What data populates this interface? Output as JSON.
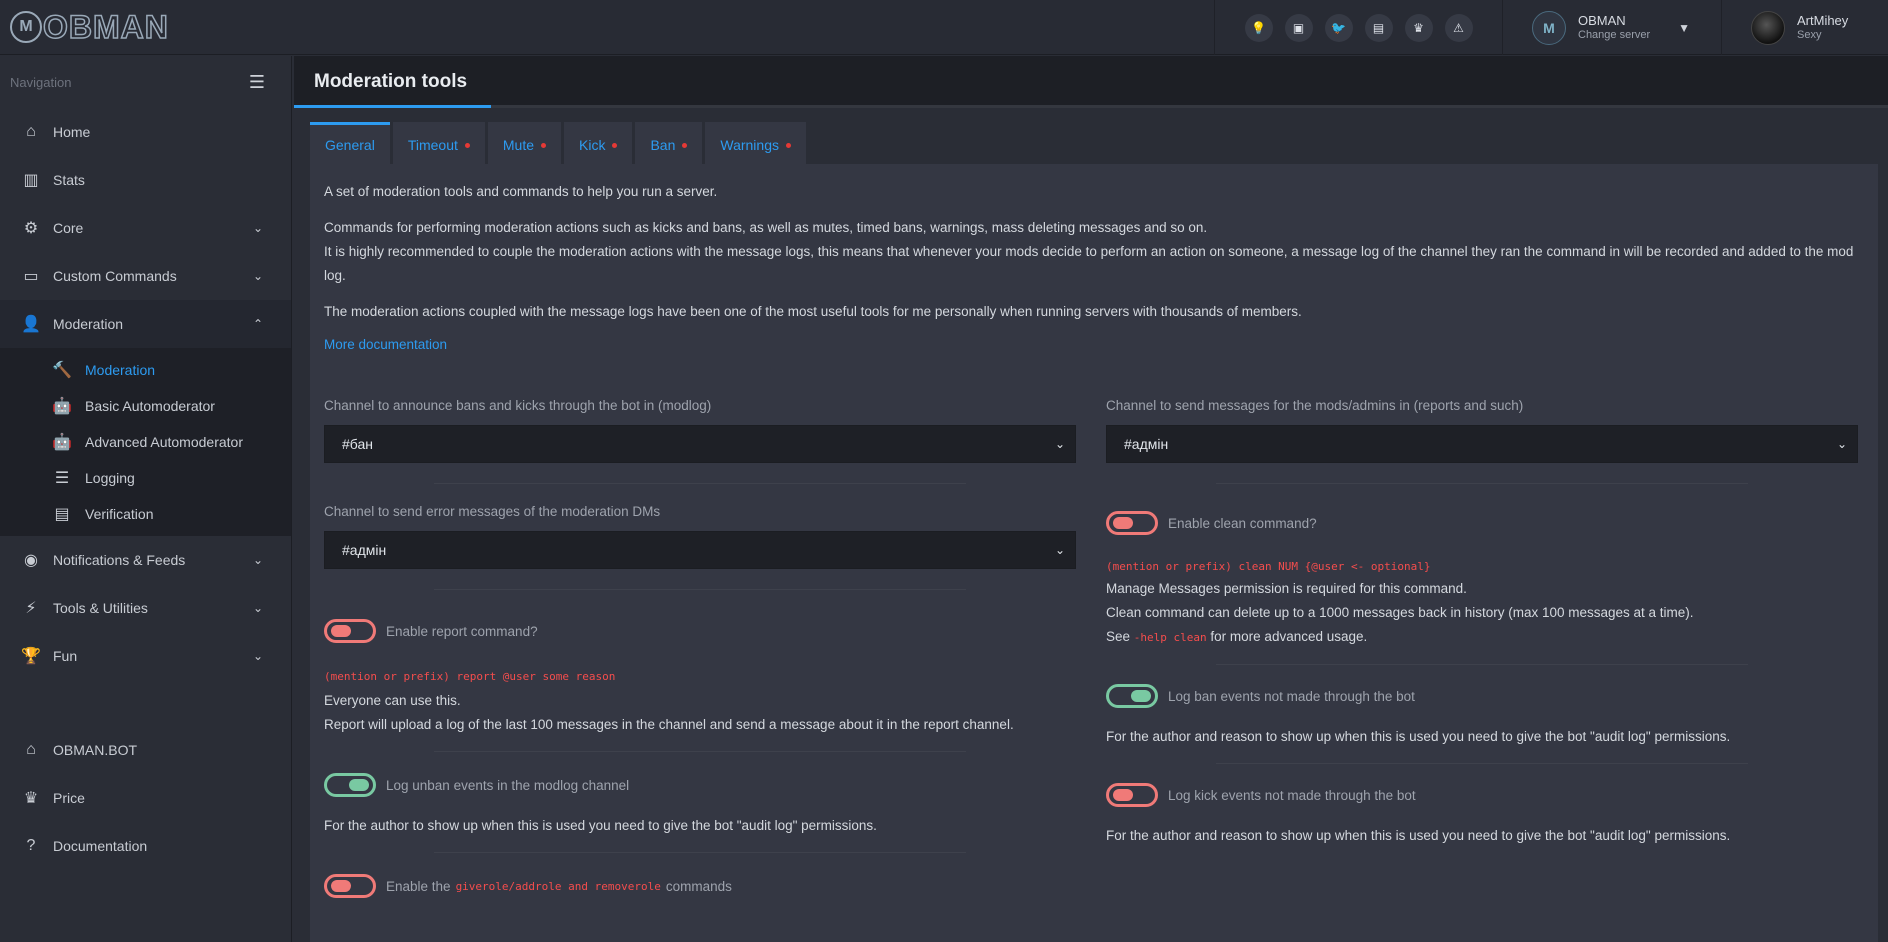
{
  "brand": {
    "logo_letter": "M",
    "logo_text": "OBMAN"
  },
  "topbar": {
    "icons": [
      "lightbulb-icon",
      "discord-icon",
      "twitter-icon",
      "ticket-icon",
      "crown-icon",
      "warning-icon"
    ],
    "icon_glyphs": [
      "💡",
      "▣",
      "🐦",
      "▤",
      "♛",
      "⚠"
    ],
    "server": {
      "name": "OBMAN",
      "subtitle": "Change server"
    },
    "user": {
      "name": "ArtMihey",
      "subtitle": "Sexy"
    }
  },
  "sidebar": {
    "heading": "Navigation",
    "items": [
      {
        "label": "Home",
        "glyph": "⌂"
      },
      {
        "label": "Stats",
        "glyph": "▥"
      },
      {
        "label": "Core",
        "glyph": "⚙"
      },
      {
        "label": "Custom Commands",
        "glyph": "▭"
      },
      {
        "label": "Moderation",
        "glyph": "👤"
      }
    ],
    "sub_items": [
      {
        "label": "Moderation",
        "glyph": "🔨"
      },
      {
        "label": "Basic Automoderator",
        "glyph": "🤖"
      },
      {
        "label": "Advanced Automoderator",
        "glyph": "🤖"
      },
      {
        "label": "Logging",
        "glyph": "☰"
      },
      {
        "label": "Verification",
        "glyph": "▤"
      }
    ],
    "items_after": [
      {
        "label": "Notifications & Feeds",
        "glyph": "◉"
      },
      {
        "label": "Tools & Utilities",
        "glyph": "⚡"
      },
      {
        "label": "Fun",
        "glyph": "🏆"
      }
    ],
    "bottom": [
      {
        "label": "OBMAN.BOT",
        "glyph": "⌂"
      },
      {
        "label": "Price",
        "glyph": "♛"
      },
      {
        "label": "Documentation",
        "glyph": "?"
      }
    ]
  },
  "page": {
    "title": "Moderation tools",
    "tabs": [
      "General",
      "Timeout",
      "Mute",
      "Kick",
      "Ban",
      "Warnings"
    ],
    "intro": [
      "A set of moderation tools and commands to help you run a server.",
      "Commands for performing moderation actions such as kicks and bans, as well as mutes, timed bans, warnings, mass deleting messages and so on.",
      "It is highly recommended to couple the moderation actions with the message logs, this means that whenever your mods decide to perform an action on someone, a message log of the channel they ran the command in will be recorded and added to the mod log.",
      "The moderation actions coupled with the message logs have been one of the most useful tools for me personally when running servers with thousands of members."
    ],
    "more_docs": "More documentation",
    "modlog_label": "Channel to announce bans and kicks through the bot in (modlog)",
    "modlog_value": "#бан",
    "report_channel_label": "Channel to send messages for the mods/admins in (reports and such)",
    "report_channel_value": "#адмін",
    "error_label": "Channel to send error messages of the moderation DMs",
    "error_value": "#адмін",
    "report_toggle": "Enable report command?",
    "report_code": "(mention or prefix) report @user some reason",
    "report_line1": "Everyone can use this.",
    "report_line2": "Report will upload a log of the last 100 messages in the channel and send a message about it in the report channel.",
    "unban_toggle": "Log unban events in the modlog channel",
    "unban_desc": "For the author to show up when this is used you need to give the bot \"audit log\" permissions.",
    "giverole_prefix": "Enable the",
    "giverole_code": "giverole/addrole and removerole",
    "giverole_suffix": "commands",
    "clean_toggle": "Enable clean command?",
    "clean_code": "(mention or prefix) clean NUM {@user <- optional}",
    "clean_line1": "Manage Messages permission is required for this command.",
    "clean_line2": "Clean command can delete up to a 1000 messages back in history (max 100 messages at a time).",
    "clean_see": "See",
    "clean_see_code": "-help clean",
    "clean_see_suffix": "for more advanced usage.",
    "ban_toggle": "Log ban events not made through the bot",
    "ban_desc": "For the author and reason to show up when this is used you need to give the bot \"audit log\" permissions.",
    "kick_toggle": "Log kick events not made through the bot",
    "kick_desc": "For the author and reason to show up when this is used you need to give the bot \"audit log\" permissions."
  },
  "colors": {
    "accent": "#2d9bf0",
    "toggle_off": "#f07a78",
    "toggle_on": "#79c9a2",
    "tab_dot": "#e53935",
    "code": "#f44d4d"
  }
}
